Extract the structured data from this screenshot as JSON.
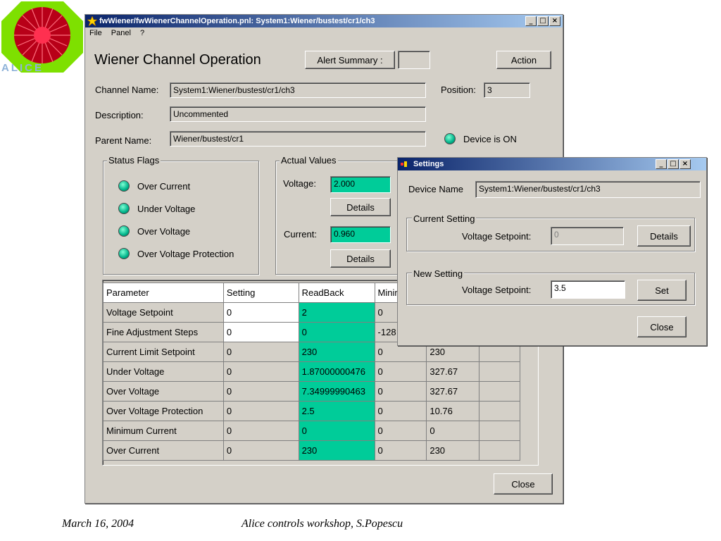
{
  "footer": {
    "date": "March 16, 2004",
    "event": "Alice controls workshop, S.Popescu"
  },
  "logo": {
    "text": "ALICE"
  },
  "main_window": {
    "title": "fwWiener/fwWienerChannelOperation.pnl: System1:Wiener/bustest/cr1/ch3",
    "menu": [
      "File",
      "Panel",
      "?"
    ],
    "heading": "Wiener Channel Operation",
    "alert_summary_label": "Alert Summary :",
    "alert_summary_value": "",
    "action_label": "Action",
    "channel_name_label": "Channel Name:",
    "channel_name_value": "System1:Wiener/bustest/cr1/ch3",
    "position_label": "Position:",
    "position_value": "3",
    "description_label": "Description:",
    "description_value": "Uncommented",
    "parent_name_label": "Parent Name:",
    "parent_name_value": "Wiener/bustest/cr1",
    "device_status": "Device is ON",
    "status_flags": {
      "title": "Status Flags",
      "items": [
        "Over Current",
        "Under Voltage",
        "Over Voltage",
        "Over Voltage Protection"
      ]
    },
    "actual_values": {
      "title": "Actual Values",
      "voltage_label": "Voltage:",
      "voltage_value": "2.000",
      "current_label": "Current:",
      "current_value": "0.960",
      "details_label": "Details"
    },
    "table": {
      "headers": [
        "Parameter",
        "Setting",
        "ReadBack",
        "Minir",
        "",
        ""
      ],
      "rows": [
        [
          "Voltage Setpoint",
          "0",
          "2",
          "0",
          "",
          ""
        ],
        [
          "Fine Adjustment Steps",
          "0",
          "0",
          "-128",
          "",
          ""
        ],
        [
          "Current Limit Setpoint",
          "0",
          "230",
          "0",
          "230",
          ""
        ],
        [
          "Under Voltage",
          "0",
          "1.87000000476",
          "0",
          "327.67",
          ""
        ],
        [
          "Over Voltage",
          "0",
          "7.34999990463",
          "0",
          "327.67",
          ""
        ],
        [
          "Over Voltage Protection",
          "0",
          "2.5",
          "0",
          "10.76",
          ""
        ],
        [
          "Minimum Current",
          "0",
          "0",
          "0",
          "0",
          ""
        ],
        [
          "Over Current",
          "0",
          "230",
          "0",
          "230",
          ""
        ]
      ]
    },
    "close_label": "Close"
  },
  "settings_window": {
    "title": "Settings",
    "device_name_label": "Device Name",
    "device_name_value": "System1:Wiener/bustest/cr1/ch3",
    "current_setting": {
      "title": "Current Setting",
      "voltage_label": "Voltage Setpoint:",
      "voltage_value": "0",
      "details_label": "Details"
    },
    "new_setting": {
      "title": "New Setting",
      "voltage_label": "Voltage Setpoint:",
      "voltage_value": "3.5",
      "set_label": "Set"
    },
    "close_label": "Close"
  },
  "colors": {
    "window_bg": "#d4d0c8",
    "title_bar": "#0a246a",
    "led_green": "#00cc99",
    "value_green": "#00cc99"
  }
}
